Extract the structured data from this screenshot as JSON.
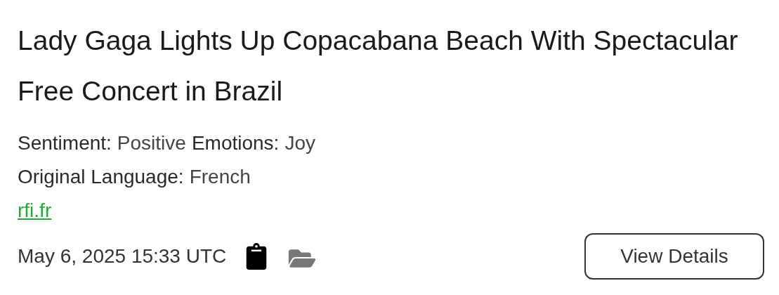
{
  "title": "Lady Gaga Lights Up Copacabana Beach With Spectacular Free Concert in Brazil",
  "meta_lines": [
    {
      "fields": [
        {
          "label": "Sentiment:",
          "value": "Positive"
        },
        {
          "label": "Emotions:",
          "value": "Joy"
        }
      ]
    },
    {
      "fields": [
        {
          "label": "Original Language:",
          "value": "French"
        }
      ]
    }
  ],
  "source_link": "rfi.fr",
  "timestamp": "May 6, 2025 15:33 UTC",
  "button": "View Details"
}
